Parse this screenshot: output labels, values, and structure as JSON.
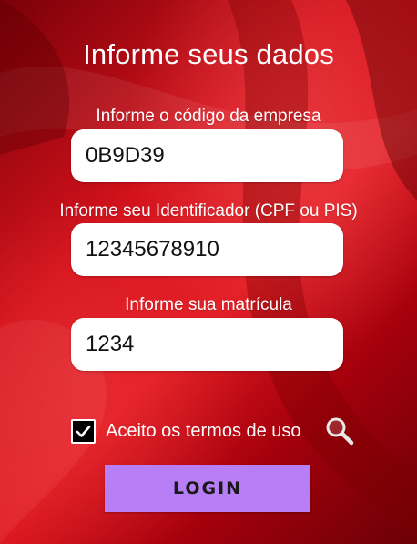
{
  "title": "Informe seus dados",
  "fields": [
    {
      "label": "Informe o código da empresa",
      "value": "0B9D39"
    },
    {
      "label": "Informe seu Identificador (CPF ou PIS)",
      "value": "12345678910"
    },
    {
      "label": "Informe sua matrícula",
      "value": "1234"
    }
  ],
  "terms": {
    "label": "Aceito os termos de uso",
    "checked": true,
    "icon": "search-icon"
  },
  "login": {
    "label": "LOGIN"
  },
  "colors": {
    "background_red": "#d4121c",
    "button_purple": "#b87ef5",
    "checkbox_black": "#000000"
  }
}
